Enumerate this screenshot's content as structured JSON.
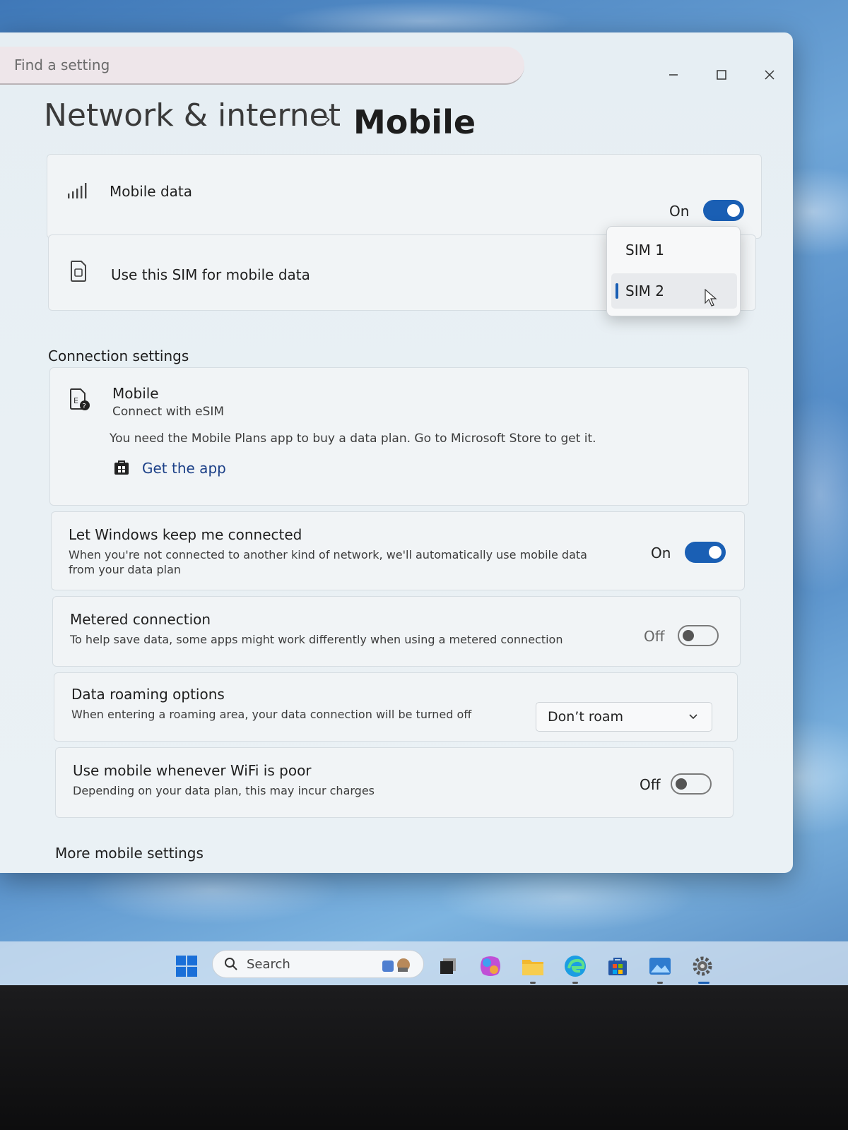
{
  "search": {
    "placeholder": "Find a setting"
  },
  "breadcrumb": {
    "root": "Network & internet",
    "separator": "›",
    "current": "Mobile"
  },
  "mobile_data": {
    "label": "Mobile data",
    "state": "On"
  },
  "sim_select": {
    "label": "Use this SIM for mobile data",
    "options": [
      "SIM 1",
      "SIM 2"
    ],
    "selected": "SIM 2"
  },
  "connection_settings": {
    "heading": "Connection settings",
    "esim": {
      "title": "Mobile",
      "subtitle": "Connect with eSIM",
      "note": "You need the Mobile Plans app to buy a data plan. Go to Microsoft Store to get it.",
      "link": "Get the app"
    },
    "keep_connected": {
      "title": "Let Windows keep me connected",
      "desc": "When you're not connected to another kind of network, we'll automatically use mobile data from your data plan",
      "state": "On"
    },
    "metered": {
      "title": "Metered connection",
      "desc": "To help save data, some apps might work differently when using a metered connection",
      "state": "Off"
    },
    "roaming": {
      "title": "Data roaming options",
      "desc": "When entering a roaming area, your data connection will be turned off",
      "selected": "Don’t roam"
    },
    "wifi_poor": {
      "title": "Use mobile whenever WiFi is poor",
      "desc": "Depending on your data plan, this may incur charges",
      "state": "Off"
    }
  },
  "more_heading": "More mobile settings",
  "taskbar": {
    "search_label": "Search",
    "accent": "#1a5fb4"
  }
}
